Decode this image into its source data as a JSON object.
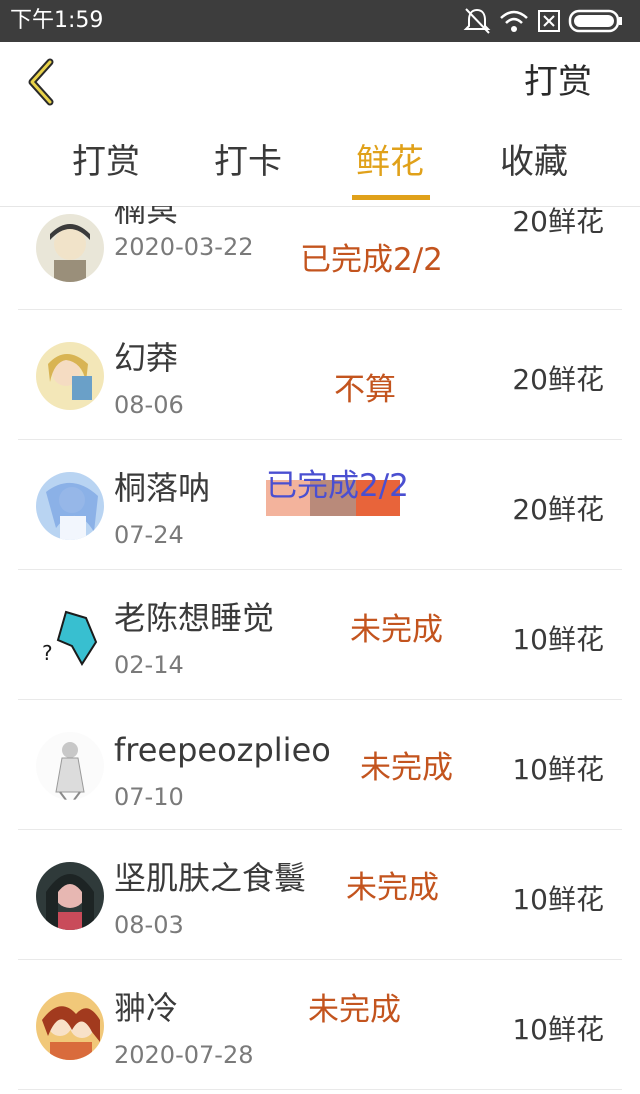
{
  "status_bar": {
    "time": "下午1:59",
    "icons": [
      "mute-icon",
      "wifi-icon",
      "sim-icon",
      "battery-icon"
    ]
  },
  "header": {
    "back_icon": "chevron-left-icon",
    "title": "打赏"
  },
  "tabs": [
    {
      "label": "打赏",
      "active": false
    },
    {
      "label": "打卡",
      "active": false
    },
    {
      "label": "鲜花",
      "active": true
    },
    {
      "label": "收藏",
      "active": false
    }
  ],
  "colors": {
    "accent": "#e0a11a",
    "annotation_orange": "#c3541e",
    "annotation_blue": "#4a4fd1",
    "status_bar": "#3d3d3d"
  },
  "rows": [
    {
      "name": "楠冥",
      "date": "2020-03-22",
      "amount": "20鲜花",
      "note": "已完成2/2"
    },
    {
      "name": "幻莽",
      "date": "08-06",
      "amount": "20鲜花",
      "note": "不算"
    },
    {
      "name": "桐落呐",
      "date": "07-24",
      "amount": "20鲜花",
      "note": "已完成2/2"
    },
    {
      "name": "老陈想睡觉",
      "date": "02-14",
      "amount": "10鲜花",
      "note": "未完成"
    },
    {
      "name": "freepeozplieo",
      "date": "07-10",
      "amount": "10鲜花",
      "note": "未完成"
    },
    {
      "name": "坚肌肤之食鬟",
      "date": "08-03",
      "amount": "10鲜花",
      "note": "未完成"
    },
    {
      "name": "翀冷",
      "date": "2020-07-28",
      "amount": "10鲜花",
      "note": "未完成"
    }
  ]
}
